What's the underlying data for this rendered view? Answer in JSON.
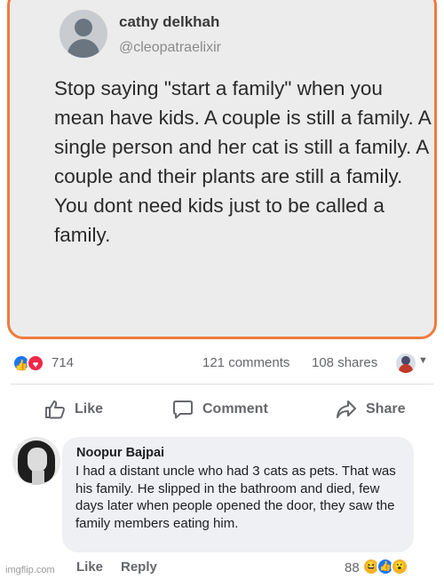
{
  "tweet": {
    "author_name": "cathy delkhah",
    "author_handle": "@cleopatraelixir",
    "text": "Stop saying \"start a family\" when you mean have kids. A couple is still a family. A single person and her cat is still a family. A couple and their plants are still a family. You dont need kids just to be called  a family."
  },
  "reactions": {
    "like_icon": "thumbs-up-icon",
    "love_icon": "heart-icon",
    "count": "714",
    "comments": "121 comments",
    "shares": "108 shares"
  },
  "actions": {
    "like": "Like",
    "comment": "Comment",
    "share": "Share"
  },
  "comment": {
    "author": "Noopur Bajpai",
    "text": "I had a distant uncle who had 3 cats as pets. That was his family. He slipped in the bathroom and died, few days later when people opened the door, they saw the family members eating him.",
    "like": "Like",
    "reply": "Reply",
    "reaction_count": "88"
  },
  "watermark": "imgflip.com",
  "colors": {
    "accent_border": "#f07a3e",
    "facebook_blue": "#1877f2",
    "love_red": "#f02849",
    "secondary_text": "#65676b"
  }
}
